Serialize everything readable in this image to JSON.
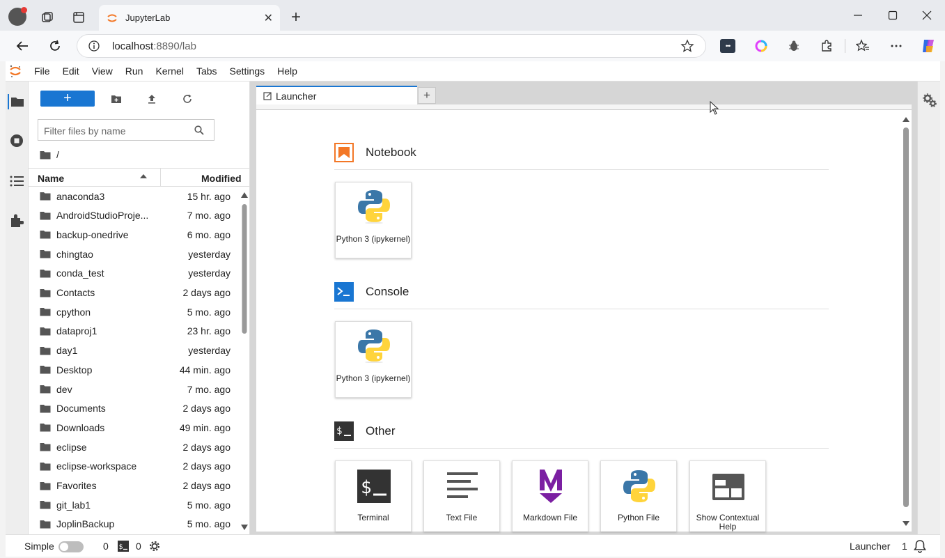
{
  "browser": {
    "tab_title": "JupyterLab",
    "url_host": "localhost",
    "url_path": ":8890/lab"
  },
  "menu": [
    "File",
    "Edit",
    "View",
    "Run",
    "Kernel",
    "Tabs",
    "Settings",
    "Help"
  ],
  "filebrowser": {
    "new_label": "+",
    "filter_placeholder": "Filter files by name",
    "path": "/",
    "col_name": "Name",
    "col_modified": "Modified",
    "files": [
      {
        "name": "anaconda3",
        "modified": "15 hr. ago"
      },
      {
        "name": "AndroidStudioProje...",
        "modified": "7 mo. ago"
      },
      {
        "name": "backup-onedrive",
        "modified": "6 mo. ago"
      },
      {
        "name": "chingtao",
        "modified": "yesterday"
      },
      {
        "name": "conda_test",
        "modified": "yesterday"
      },
      {
        "name": "Contacts",
        "modified": "2 days ago"
      },
      {
        "name": "cpython",
        "modified": "5 mo. ago"
      },
      {
        "name": "dataproj1",
        "modified": "23 hr. ago"
      },
      {
        "name": "day1",
        "modified": "yesterday"
      },
      {
        "name": "Desktop",
        "modified": "44 min. ago"
      },
      {
        "name": "dev",
        "modified": "7 mo. ago"
      },
      {
        "name": "Documents",
        "modified": "2 days ago"
      },
      {
        "name": "Downloads",
        "modified": "49 min. ago"
      },
      {
        "name": "eclipse",
        "modified": "2 days ago"
      },
      {
        "name": "eclipse-workspace",
        "modified": "2 days ago"
      },
      {
        "name": "Favorites",
        "modified": "2 days ago"
      },
      {
        "name": "git_lab1",
        "modified": "5 mo. ago"
      },
      {
        "name": "JoplinBackup",
        "modified": "5 mo. ago"
      }
    ]
  },
  "main": {
    "tab_label": "Launcher",
    "add_tab": "+",
    "sections": {
      "notebook": "Notebook",
      "console": "Console",
      "other": "Other"
    },
    "cards": {
      "notebook_py": "Python 3 (ipykernel)",
      "console_py": "Python 3 (ipykernel)",
      "terminal": "Terminal",
      "textfile": "Text File",
      "markdown": "Markdown File",
      "pythonfile": "Python File",
      "contextual": "Show Contextual Help"
    }
  },
  "status": {
    "mode_label": "Simple",
    "kernels_count": "0",
    "terminals_count": "0",
    "right_label": "Launcher",
    "notifications": "1"
  },
  "colors": {
    "accent": "#1976d2",
    "jupyter_orange": "#f37726",
    "python_blue": "#3b77a8",
    "python_yellow": "#ffd43b"
  }
}
